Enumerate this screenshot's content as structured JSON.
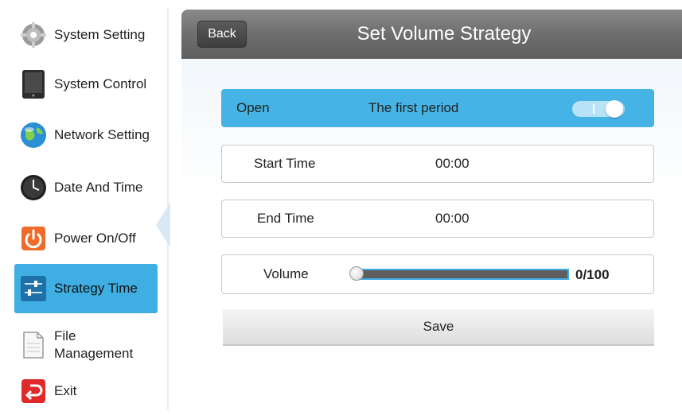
{
  "sidebar": {
    "items": [
      {
        "label": "System Setting",
        "icon": "gear-icon"
      },
      {
        "label": "System Control",
        "icon": "tablet-icon"
      },
      {
        "label": "Network Setting",
        "icon": "globe-icon"
      },
      {
        "label": "Date And Time",
        "icon": "clock-icon"
      },
      {
        "label": "Power On/Off",
        "icon": "power-icon"
      },
      {
        "label": "Strategy Time",
        "icon": "sliders-icon",
        "active": true
      },
      {
        "label": "File\nManagement",
        "label_line1": "File",
        "label_line2": "Management",
        "icon": "document-icon"
      },
      {
        "label": "Exit",
        "icon": "exit-icon"
      }
    ]
  },
  "header": {
    "back_label": "Back",
    "title": "Set Volume Strategy"
  },
  "form": {
    "open_label": "Open",
    "period_label": "The first period",
    "open_toggle_on": true,
    "start_time_label": "Start Time",
    "start_time_value": "00:00",
    "end_time_label": "End Time",
    "end_time_value": "00:00",
    "volume_label": "Volume",
    "volume_value": 0,
    "volume_max": 100,
    "volume_text": "0/100",
    "save_label": "Save"
  },
  "colors": {
    "accent": "#3faee3",
    "title_bar": "#6e6e6e",
    "exit_red": "#e02a2a",
    "power_orange": "#f06a2a"
  }
}
